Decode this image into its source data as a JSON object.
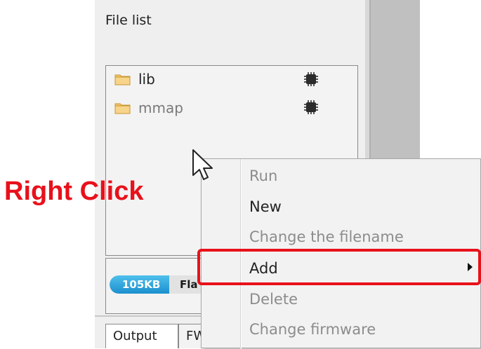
{
  "panel": {
    "title": "File list"
  },
  "files": [
    {
      "name": "lib",
      "icon": "folder-icon",
      "status_icon": "chip-icon"
    },
    {
      "name": "mmap",
      "icon": "folder-icon",
      "status_icon": "chip-icon"
    }
  ],
  "flash": {
    "size": "105KB",
    "label": "Fla"
  },
  "tabs": [
    "Output",
    "FW"
  ],
  "annotation": {
    "text": "Right Click",
    "color": "#e8111b"
  },
  "context_menu": {
    "items": [
      {
        "label": "Run",
        "enabled": false
      },
      {
        "label": "New",
        "enabled": true
      },
      {
        "label": "Change the filename",
        "enabled": false
      },
      {
        "label": "Add",
        "enabled": true,
        "has_submenu": true,
        "highlighted": true
      },
      {
        "label": "Delete",
        "enabled": false
      },
      {
        "label": "Change firmware",
        "enabled": false
      }
    ]
  },
  "colors": {
    "highlight": "#e8111b",
    "flash_fill": "#1b8fce",
    "folder": "#f2c46d"
  }
}
